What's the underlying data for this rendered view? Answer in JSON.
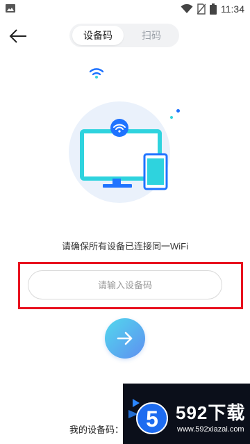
{
  "status_bar": {
    "time": "11:34",
    "icons": [
      "gallery-icon",
      "wifi-icon",
      "no-sim-icon",
      "battery-icon"
    ]
  },
  "header": {
    "back_icon": "arrow-left-icon",
    "tabs": [
      {
        "label": "设备码",
        "active": true
      },
      {
        "label": "扫码",
        "active": false
      }
    ]
  },
  "illustration": {
    "icons": [
      "wifi-icon",
      "monitor-icon",
      "phone-icon"
    ],
    "colors": {
      "accent_blue": "#1f73ff",
      "cyan": "#34d2dc",
      "circle_bg": "#eaf1fb"
    }
  },
  "hint": "请确保所有设备已连接同一WiFi",
  "device_code_input": {
    "placeholder": "请输入设备码",
    "value": ""
  },
  "next_button": {
    "icon": "arrow-right-icon"
  },
  "my_code_label": "我的设备码：",
  "watermark": {
    "logo_text": "5",
    "title": "592下载",
    "url": "www.592xiazai.com"
  },
  "colors": {
    "highlight_border": "#e8121f",
    "button_gradient_start": "#52d8ee",
    "button_gradient_end": "#5e8ff0"
  }
}
